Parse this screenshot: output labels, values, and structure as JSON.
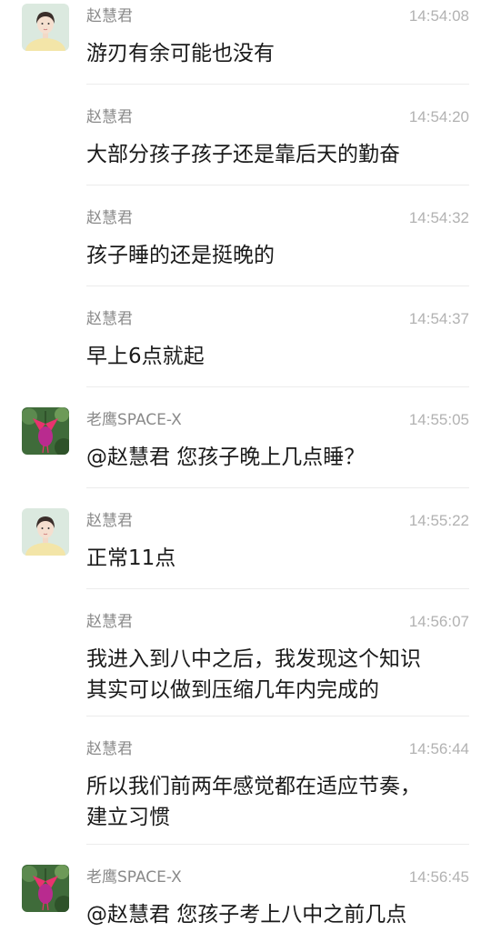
{
  "messages": [
    {
      "sender": "赵慧君",
      "time": "14:54:08",
      "text": "游刃有余可能也没有",
      "avatar": "woman-avatar"
    },
    {
      "sender": "赵慧君",
      "time": "14:54:20",
      "text": "大部分孩子孩子还是靠后天的勤奋",
      "avatar": ""
    },
    {
      "sender": "赵慧君",
      "time": "14:54:32",
      "text": "孩子睡的还是挺晚的",
      "avatar": ""
    },
    {
      "sender": "赵慧君",
      "time": "14:54:37",
      "text": "早上6点就起",
      "avatar": ""
    },
    {
      "sender": "老鹰SPACE-X",
      "time": "14:55:05",
      "text": "@赵慧君 您孩子晚上几点睡？",
      "avatar": "flower-avatar"
    },
    {
      "sender": "赵慧君",
      "time": "14:55:22",
      "text": "正常11点",
      "avatar": "woman-avatar"
    },
    {
      "sender": "赵慧君",
      "time": "14:56:07",
      "text": "我进入到八中之后，我发现这个知识\n其实可以做到压缩几年内完成的",
      "avatar": ""
    },
    {
      "sender": "赵慧君",
      "time": "14:56:44",
      "text": "所以我们前两年感觉都在适应节奏，\n建立习惯",
      "avatar": ""
    },
    {
      "sender": "老鹰SPACE-X",
      "time": "14:56:45",
      "text": "@赵慧君 您孩子考上八中之前几点\n睡？",
      "avatar": "flower-avatar"
    }
  ]
}
